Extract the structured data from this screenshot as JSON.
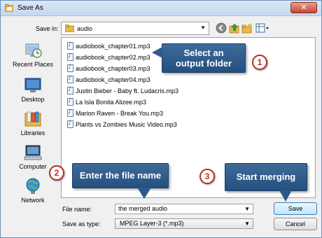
{
  "window": {
    "title": "Save As",
    "close_symbol": "✕"
  },
  "toolbar": {
    "save_in_label": "Save in:",
    "save_in_value": "audio",
    "icons": [
      "back-icon",
      "up-folder-icon",
      "new-folder-icon",
      "views-menu-icon"
    ]
  },
  "places": [
    {
      "label": "Recent Places",
      "icon": "recent-places-icon"
    },
    {
      "label": "Desktop",
      "icon": "desktop-icon"
    },
    {
      "label": "Libraries",
      "icon": "libraries-icon"
    },
    {
      "label": "Computer",
      "icon": "computer-icon"
    },
    {
      "label": "Network",
      "icon": "network-icon"
    }
  ],
  "files": [
    "audiobook_chapter01.mp3",
    "audiobook_chapter02.mp3",
    "audiobook_chapter03.mp3",
    "audiobook_chapter04.mp3",
    "Justin Bieber - Baby ft. Ludacris.mp3",
    "La Isla Bonita Alizee.mp3",
    "Marion Raven - Break You.mp3",
    "Plants vs Zombies Music Video.mp3"
  ],
  "form": {
    "file_name_label": "File name:",
    "file_name_value": "the merged audio",
    "save_as_type_label": "Save as type:",
    "save_as_type_value": "MPEG Layer-3 (*.mp3)"
  },
  "buttons": {
    "save": "Save",
    "cancel": "Cancel"
  },
  "callouts": [
    {
      "number": "1",
      "text_line1": "Select an",
      "text_line2": "output folder"
    },
    {
      "number": "2",
      "text": "Enter the file name"
    },
    {
      "number": "3",
      "text": "Start merging"
    }
  ],
  "colors": {
    "callout_bg": "#2e5a8a",
    "badge_ring": "#b9301f",
    "close_button": "#c7462f"
  }
}
